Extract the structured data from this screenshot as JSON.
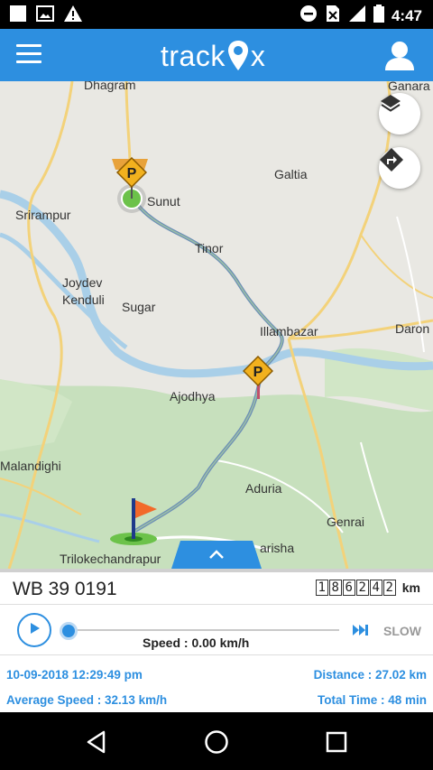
{
  "status_bar": {
    "time": "4:47",
    "left_icons": [
      "white-square-icon",
      "image-icon",
      "warning-icon"
    ],
    "right_icons": [
      "do-not-disturb-icon",
      "no-sim-icon",
      "signal-icon",
      "battery-icon"
    ]
  },
  "app_bar": {
    "logo_text_left": "track",
    "logo_text_right": "x",
    "menu_icon": "hamburger-menu-icon",
    "profile_icon": "user-icon",
    "color": "#2d8fe0"
  },
  "map": {
    "labels": {
      "dhagram": "Dhagram",
      "ganara": "Ganara",
      "galtia": "Galtia",
      "sunut": "Sunut",
      "srirampur": "Srirampur",
      "tinor": "Tinor",
      "joydev": "Joydev",
      "kenduli": "Kenduli",
      "sugar": "Sugar",
      "illambazar": "Illambazar",
      "daron": "Daron",
      "ajodhya": "Ajodhya",
      "malandighi": "Malandighi",
      "aduria": "Aduria",
      "genrai": "Genrai",
      "trilokechandrapur": "Trilokechandrapur",
      "arisha": "arisha"
    },
    "layers_icon": "layers-icon",
    "directions_icon": "directions-icon"
  },
  "vehicle": {
    "number": "WB 39 0191",
    "odometer_digits": [
      "1",
      "8",
      "6",
      "2",
      "4",
      "2"
    ],
    "odometer_unit": "km"
  },
  "playback": {
    "speed_text": "Speed : 0.00 km/h",
    "slow_label": "SLOW",
    "progress": 0.0
  },
  "stats": {
    "datetime": "10-09-2018 12:29:49 pm",
    "distance": "Distance : 27.02 km",
    "avg_speed": "Average Speed : 32.13 km/h",
    "total_time": "Total Time : 48 min"
  },
  "nav_bar": {
    "back_icon": "back-icon",
    "home_icon": "home-icon",
    "recents_icon": "recents-icon"
  }
}
